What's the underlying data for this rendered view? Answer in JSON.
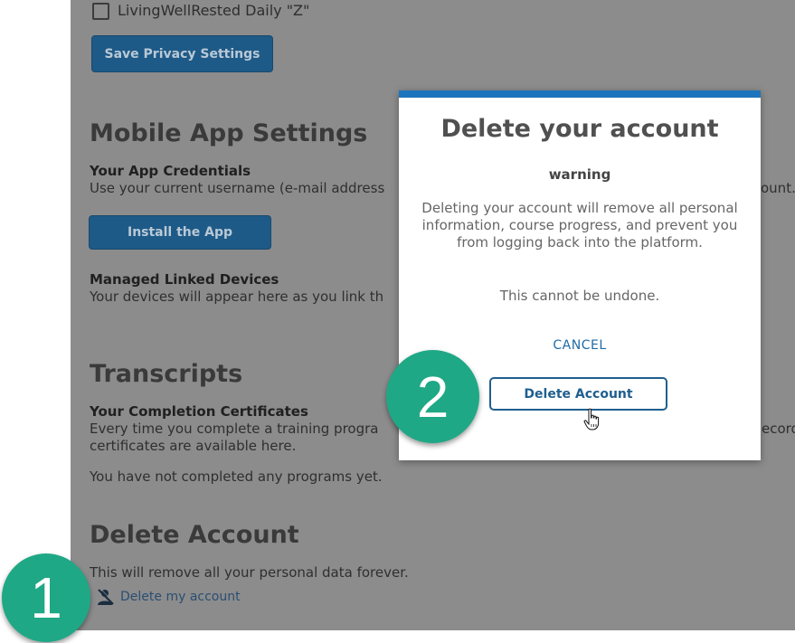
{
  "privacy": {
    "checkbox_label": "LivingWellRested Daily \"Z\"",
    "save_label": "Save Privacy Settings"
  },
  "mobile": {
    "heading": "Mobile App Settings",
    "credentials_title": "Your App Credentials",
    "credentials_text": "Use your current username (e-mail address",
    "credentials_text_tail": "ount.",
    "install_label": "Install the App",
    "devices_title": "Managed Linked Devices",
    "devices_text": "Your devices will appear here as you link th"
  },
  "transcripts": {
    "heading": "Transcripts",
    "certs_title": "Your Completion Certificates",
    "certs_text_1": "Every time you complete a training progra",
    "certs_text_1_tail": "ecord",
    "certs_text_2": "certificates are available here.",
    "none_text": "You have not completed any programs yet."
  },
  "delete": {
    "heading": "Delete Account",
    "description": "This will remove all your personal data forever.",
    "link_label": "Delete my account"
  },
  "modal": {
    "title": "Delete your account",
    "warning": "warning",
    "body": "Deleting your account will remove all personal information, course progress, and prevent you from logging back into the platform.",
    "undone": "This cannot be undone.",
    "cancel_label": "CANCEL",
    "confirm_label": "Delete Account",
    "accent_color": "#1c75bc"
  },
  "badges": {
    "step1": "1",
    "step2": "2",
    "color": "#1fa885"
  },
  "icons": [
    "user-x-icon",
    "hand-pointer-icon"
  ]
}
